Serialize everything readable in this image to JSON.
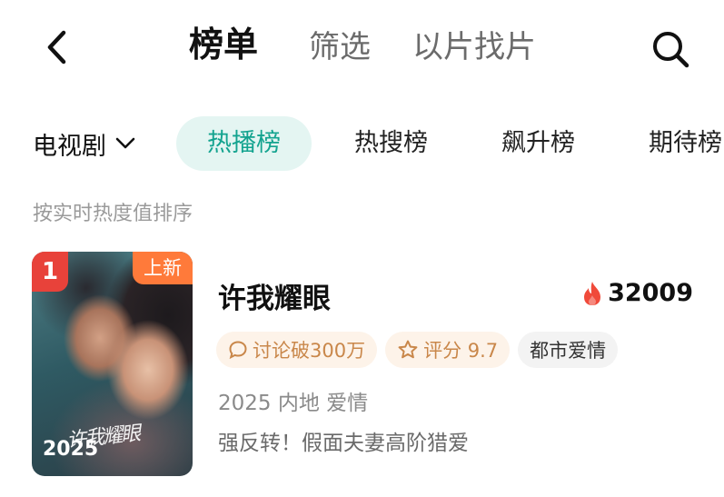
{
  "header": {
    "tabs": [
      {
        "label": "榜单",
        "active": true
      },
      {
        "label": "筛选",
        "active": false
      },
      {
        "label": "以片找片",
        "active": false
      }
    ],
    "back_icon": "chevron-left-icon",
    "search_icon": "search-icon"
  },
  "categories": {
    "dropdown_label": "电视剧",
    "dropdown_icon": "chevron-down-icon",
    "chips": [
      {
        "label": "热播榜",
        "active": true
      },
      {
        "label": "热搜榜",
        "active": false
      },
      {
        "label": "飙升榜",
        "active": false
      },
      {
        "label": "期待榜",
        "active": false
      }
    ]
  },
  "sort_hint": "按实时热度值排序",
  "items": [
    {
      "rank": "1",
      "badge": "上新",
      "poster_title": "许我耀眼",
      "poster_year": "2025",
      "title": "许我耀眼",
      "heat": "32009",
      "tags": {
        "discuss": "讨论破300万",
        "score": "评分 9.7",
        "genre": "都市爱情"
      },
      "meta": "2025 内地 爱情",
      "desc": "强反转！假面夫妻高阶猎爱"
    }
  ],
  "colors": {
    "accent": "#13a38f",
    "accent_bg": "#e4f5f2",
    "rank_red": "#e8423a",
    "new_orange": "#ff7a3a",
    "heat_red": "#f04a3a",
    "tag_gold": "#c9874a"
  }
}
